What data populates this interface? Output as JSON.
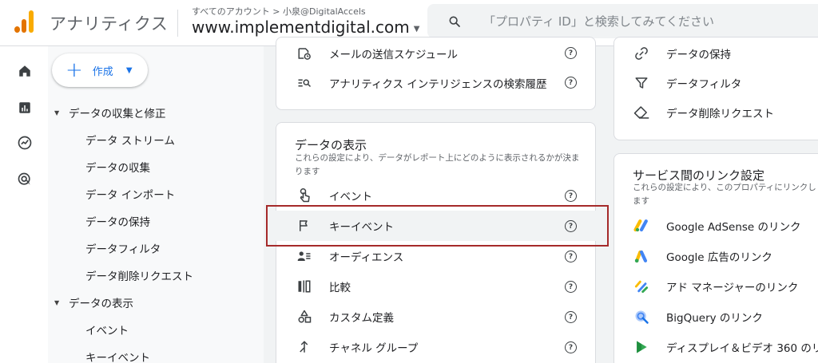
{
  "header": {
    "app_name": "アナリティクス",
    "account_path": "すべてのアカウント > 小泉@DigitalAccels",
    "property_name": "www.implementdigital.com",
    "search_placeholder": "「プロパティ ID」と検索してみてください"
  },
  "rail": {
    "icons": [
      "home-icon",
      "reports-icon",
      "explore-icon",
      "advertising-icon"
    ]
  },
  "nav": {
    "create_label": "作成",
    "section_collection": "データの収集と修正",
    "collection_items": [
      "データ ストリーム",
      "データの収集",
      "データ インポート",
      "データの保持",
      "データフィルタ",
      "データ削除リクエスト"
    ],
    "section_display": "データの表示",
    "display_items": [
      "イベント",
      "キーイベント"
    ]
  },
  "card_top_left": {
    "rows": [
      {
        "label": "メールの送信スケジュール",
        "icon": "scheduled-email-icon"
      },
      {
        "label": "アナリティクス インテリジェンスの検索履歴",
        "icon": "search-history-icon"
      }
    ]
  },
  "card_top_right": {
    "rows": [
      {
        "label": "データの保持",
        "icon": "link-icon"
      },
      {
        "label": "データフィルタ",
        "icon": "filter-icon"
      },
      {
        "label": "データ削除リクエスト",
        "icon": "eraser-icon"
      }
    ]
  },
  "card_display": {
    "title": "データの表示",
    "description": "これらの設定により、データがレポート上にどのように表示されるかが決まります",
    "rows": [
      {
        "label": "イベント",
        "icon": "touch-icon"
      },
      {
        "label": "キーイベント",
        "icon": "flag-icon"
      },
      {
        "label": "オーディエンス",
        "icon": "audience-icon"
      },
      {
        "label": "比較",
        "icon": "compare-icon"
      },
      {
        "label": "カスタム定義",
        "icon": "custom-definitions-icon"
      },
      {
        "label": "チャネル グループ",
        "icon": "channel-group-icon"
      }
    ]
  },
  "card_links": {
    "title": "サービス間のリンク設定",
    "description": "これらの設定により、このプロパティにリンクします",
    "rows": [
      {
        "label": "Google AdSense のリンク",
        "icon": "adsense-icon"
      },
      {
        "label": "Google 広告のリンク",
        "icon": "google-ads-icon"
      },
      {
        "label": "アド マネージャーのリンク",
        "icon": "ad-manager-icon"
      },
      {
        "label": "BigQuery のリンク",
        "icon": "bigquery-icon"
      },
      {
        "label": "ディスプレイ＆ビデオ 360 のリ",
        "icon": "dv360-icon"
      }
    ]
  },
  "help_symbol": "?",
  "colors": {
    "accent": "#1a73e8",
    "highlight_frame": "#a52a2a",
    "logo_orange": "#f9ab00",
    "logo_dark_orange": "#e37400"
  }
}
